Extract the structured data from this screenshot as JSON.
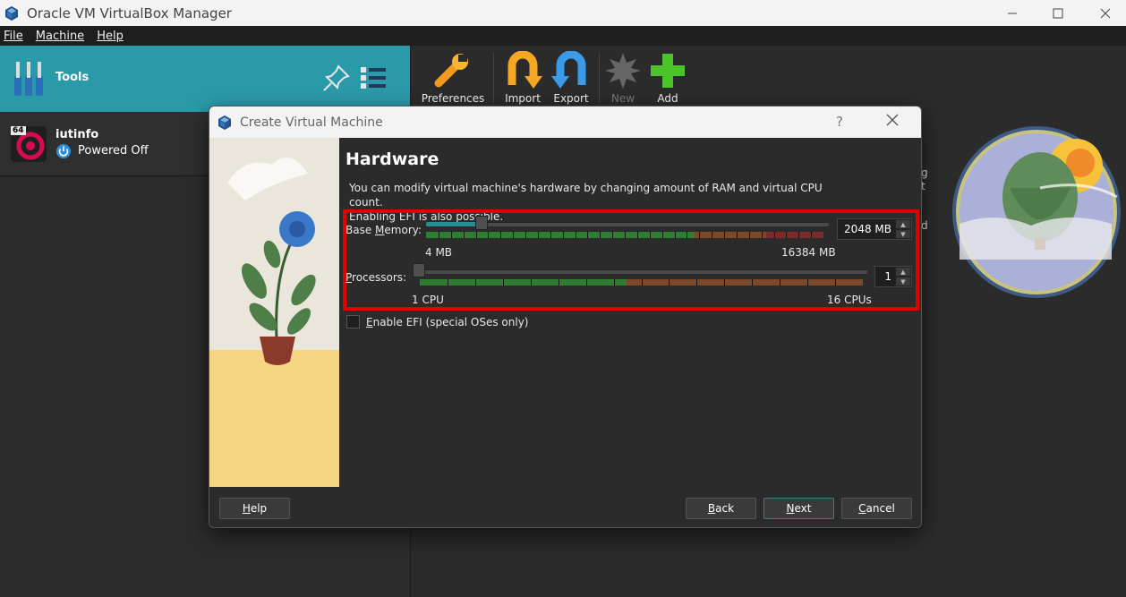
{
  "window": {
    "title": "Oracle VM VirtualBox Manager"
  },
  "menu": [
    "File",
    "Machine",
    "Help"
  ],
  "left": {
    "tools_label": "Tools",
    "vm": {
      "name": "iutinfo",
      "state": "Powered Off",
      "arch_badge": "64"
    }
  },
  "toolbar": {
    "preferences": "Preferences",
    "import": "Import",
    "export": "Export",
    "new": "New",
    "add": "Add"
  },
  "dialog": {
    "title": "Create Virtual Machine",
    "help_glyph": "?",
    "page_title": "Hardware",
    "description_line1": "You can modify virtual machine's hardware by changing amount of RAM and virtual CPU count.",
    "description_line2": "Enabling EFI is also possible.",
    "memory": {
      "label_pre": "Base ",
      "label_ul": "M",
      "label_post": "emory:",
      "min_label": "4 MB",
      "max_label": "16384 MB",
      "value": "2048 MB",
      "level": 0.125
    },
    "processors": {
      "label_ul": "P",
      "label_post": "rocessors:",
      "min_label": "1 CPU",
      "max_label": "16 CPUs",
      "value": "1",
      "level": 0
    },
    "efi": {
      "label_ul": "E",
      "label_post": "nable EFI (special OSes only)",
      "checked": false
    },
    "buttons": {
      "help_ul": "H",
      "help_post": "elp",
      "back_ul": "B",
      "back_post": "ack",
      "next_ul": "N",
      "next_post": "ext",
      "cancel_ul": "C",
      "cancel_post": "ancel"
    }
  },
  "partial_text": {
    "a": "g",
    "b": "t",
    "c": "d"
  },
  "colors": {
    "tools_bg": "#2a9aa9",
    "highlight": "#e10000",
    "scale_green": "#2e7d32",
    "scale_orange": "#7a4a2a",
    "scale_red": "#7a2a2a"
  }
}
